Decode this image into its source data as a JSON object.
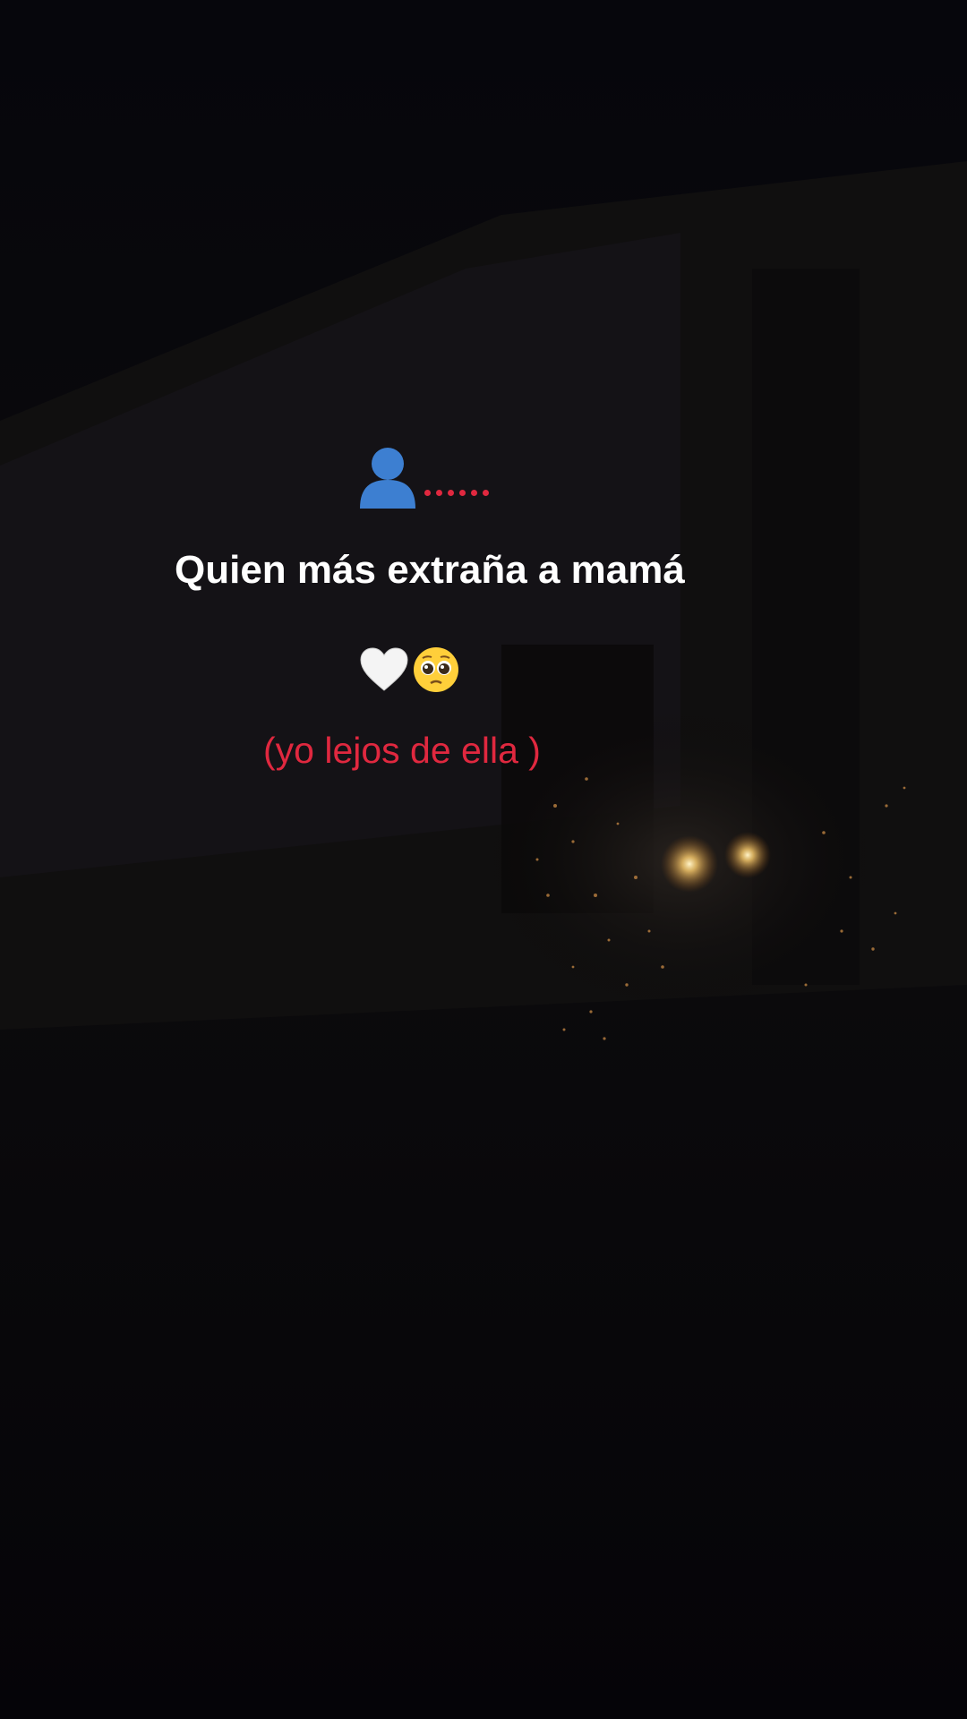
{
  "overlay": {
    "main_text": "Quien más extraña a mamá",
    "sub_text": "(yo lejos de ella )"
  },
  "icons": [
    "person-silhouette-icon",
    "red-dots-icon",
    "white-heart-icon",
    "pleading-face-icon"
  ],
  "colors": {
    "background": "#050408",
    "main_text": "#ffffff",
    "accent_red": "#e0283f",
    "person_blue": "#3d7fd1",
    "light_glow": "#ffd58a"
  }
}
